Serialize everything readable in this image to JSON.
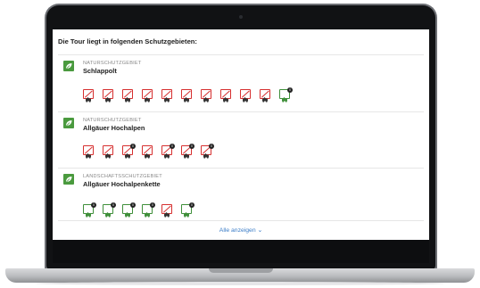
{
  "heading": "Die Tour liegt in folgenden Schutzgebieten:",
  "areas": [
    {
      "type": "NATURSCHUTZGEBIET",
      "name": "Schlappolt",
      "icons": [
        {
          "name": "no-horse-riding-icon",
          "color": "red",
          "info": false
        },
        {
          "name": "no-camping-icon",
          "color": "red",
          "info": false
        },
        {
          "name": "no-parking-icon",
          "color": "red",
          "info": false
        },
        {
          "name": "no-vehicles-icon",
          "color": "red",
          "info": false
        },
        {
          "name": "no-fire-icon",
          "color": "red",
          "info": false
        },
        {
          "name": "no-hiking-off-path-icon",
          "color": "red",
          "info": false
        },
        {
          "name": "no-dogs-icon",
          "color": "red",
          "info": false
        },
        {
          "name": "no-cycling-icon",
          "color": "red",
          "info": false
        },
        {
          "name": "no-drones-icon",
          "color": "red",
          "info": false
        },
        {
          "name": "no-picking-plants-icon",
          "color": "red",
          "info": false
        },
        {
          "name": "restricted-access-icon",
          "color": "green",
          "info": true
        }
      ]
    },
    {
      "type": "NATURSCHUTZGEBIET",
      "name": "Allgäuer Hochalpen",
      "icons": [
        {
          "name": "no-camping-icon",
          "color": "red",
          "info": false
        },
        {
          "name": "no-vehicles-icon",
          "color": "red",
          "info": false
        },
        {
          "name": "no-parking-icon",
          "color": "red",
          "info": true
        },
        {
          "name": "no-picking-plants-icon",
          "color": "red",
          "info": false
        },
        {
          "name": "no-fire-icon",
          "color": "red",
          "info": true
        },
        {
          "name": "no-cycling-icon",
          "color": "red",
          "info": true
        },
        {
          "name": "no-drones-icon",
          "color": "red",
          "info": true
        }
      ]
    },
    {
      "type": "LANDSCHAFTSSCHUTZGEBIET",
      "name": "Allgäuer Hochalpenkette",
      "icons": [
        {
          "name": "vehicles-info-icon",
          "color": "green",
          "info": true
        },
        {
          "name": "parking-info-icon",
          "color": "green",
          "info": true
        },
        {
          "name": "camping-info-icon",
          "color": "green",
          "info": true
        },
        {
          "name": "boating-info-icon",
          "color": "green",
          "info": true
        },
        {
          "name": "no-dogs-icon",
          "color": "red",
          "info": false
        },
        {
          "name": "drones-info-icon",
          "color": "green",
          "info": true
        }
      ]
    }
  ],
  "show_all_label": "Alle anzeigen ⌄",
  "colors": {
    "prohibited": "#d62f2f",
    "permitted": "#3f8f3a",
    "leaf": "#4a9a3e",
    "link": "#3a7cc7"
  }
}
